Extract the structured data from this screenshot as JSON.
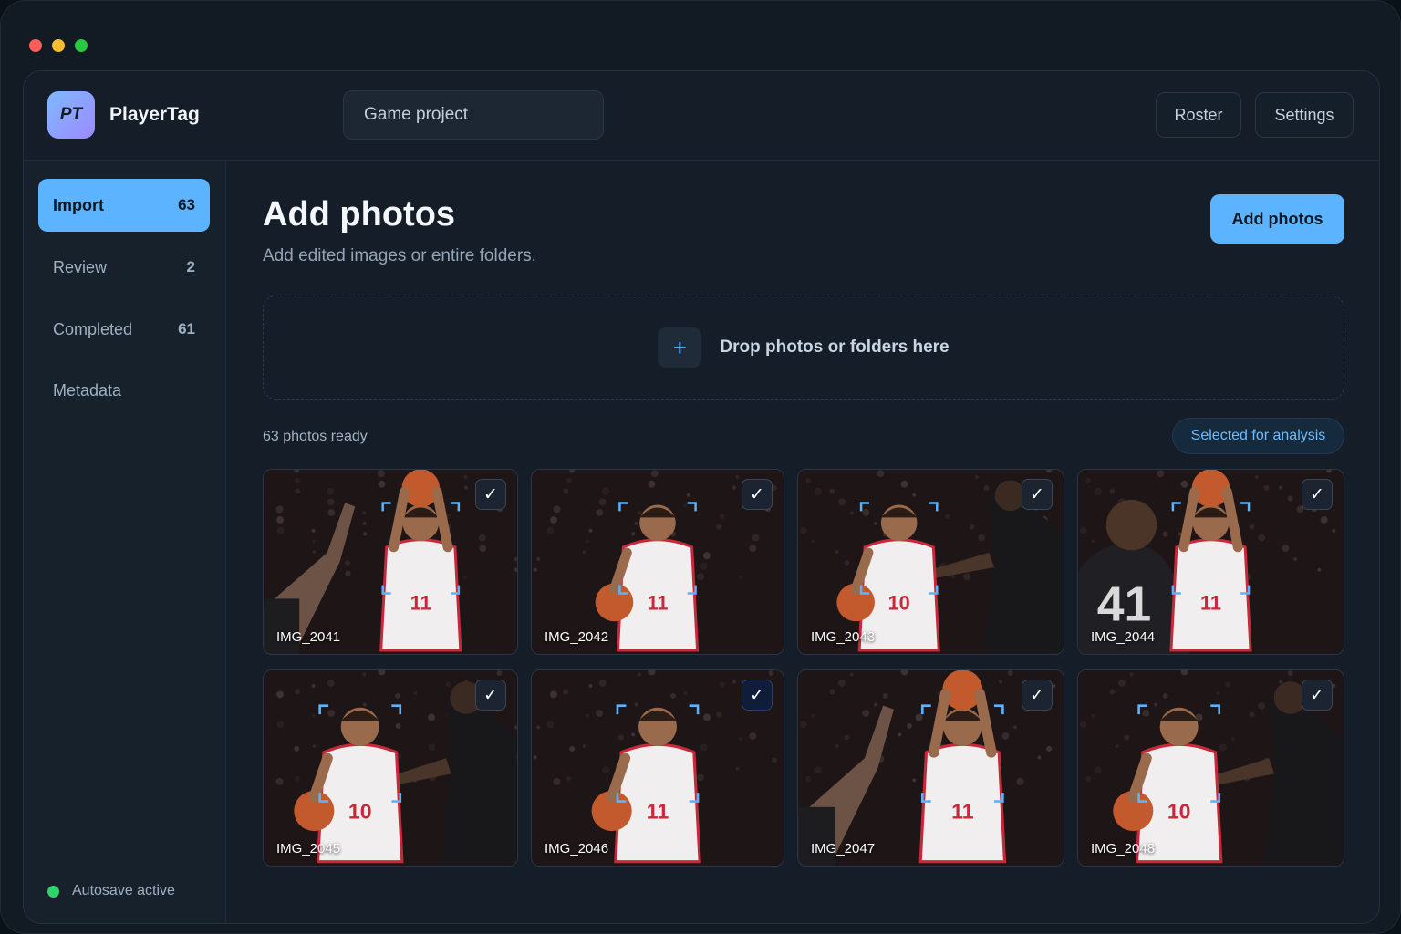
{
  "window": {
    "controls": [
      "#ff5f57",
      "#febc2e",
      "#28c840"
    ]
  },
  "header": {
    "logo_text": "PT",
    "app_name": "PlayerTag",
    "project_field": "Game project",
    "roster_label": "Roster",
    "settings_label": "Settings"
  },
  "sidebar": {
    "items": [
      {
        "label": "Import",
        "count": "63",
        "active": true
      },
      {
        "label": "Review",
        "count": "2",
        "active": false
      },
      {
        "label": "Completed",
        "count": "61",
        "active": false
      },
      {
        "label": "Metadata",
        "count": "",
        "active": false
      }
    ],
    "autosave_label": "Autosave active",
    "autosave_color": "#2ed36b"
  },
  "main": {
    "title": "Add photos",
    "subtitle": "Add edited images or entire folders.",
    "add_button": "Add photos",
    "dropzone_label": "Drop photos or folders here",
    "dropzone_icon": "plus-icon",
    "ready_text": "63 photos ready",
    "selected_pill": "Selected for analysis",
    "accent_color": "#5cb3ff"
  },
  "photos": [
    {
      "name": "IMG_2041",
      "checked": true,
      "jersey": "11",
      "pose": "shoot",
      "defender": "left-arm"
    },
    {
      "name": "IMG_2042",
      "checked": true,
      "jersey": "11",
      "pose": "dribble",
      "defender": "none"
    },
    {
      "name": "IMG_2043",
      "checked": true,
      "jersey": "10",
      "pose": "dribble",
      "defender": "right-dark"
    },
    {
      "name": "IMG_2044",
      "checked": true,
      "jersey": "11",
      "pose": "shoot",
      "defender": "back-41"
    },
    {
      "name": "IMG_2045",
      "checked": true,
      "jersey": "10",
      "pose": "dribble",
      "defender": "right-dark"
    },
    {
      "name": "IMG_2046",
      "checked": true,
      "jersey": "11",
      "pose": "dribble",
      "defender": "none"
    },
    {
      "name": "IMG_2047",
      "checked": true,
      "jersey": "11",
      "pose": "shoot",
      "defender": "left-arm"
    },
    {
      "name": "IMG_2048",
      "checked": true,
      "jersey": "10",
      "pose": "dribble",
      "defender": "right-dark"
    }
  ],
  "back_jersey": "41",
  "check_glyph": "✓"
}
